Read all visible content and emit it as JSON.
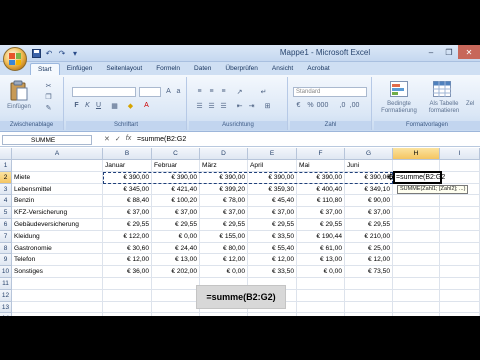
{
  "window": {
    "title": "Mappe1 - Microsoft Excel"
  },
  "tabs": [
    "Start",
    "Einfügen",
    "Seitenlayout",
    "Formeln",
    "Daten",
    "Überprüfen",
    "Ansicht",
    "Acrobat"
  ],
  "active_tab": "Start",
  "ribbon": {
    "paste_label": "Einfügen",
    "groups": {
      "clipboard": "Zwischenablage",
      "font": "Schriftart",
      "alignment": "Ausrichtung",
      "number": "Zahl",
      "templates": "Formatvorlagen"
    },
    "number_format_value": "Standard",
    "cond_format_label": "Bedingte Formatierung",
    "table_format_label": "Als Tabelle formatieren",
    "cell_styles_label": "Zel"
  },
  "formula_bar": {
    "name_box": "SUMME",
    "formula": "=summe(B2:G2"
  },
  "columns": [
    "A",
    "B",
    "C",
    "D",
    "E",
    "F",
    "G",
    "H",
    "I"
  ],
  "rows": [
    "1",
    "2",
    "3",
    "4",
    "5",
    "6",
    "7",
    "8",
    "9",
    "10",
    "11",
    "12",
    "13",
    "14"
  ],
  "sheet": {
    "months": [
      "Januar",
      "Februar",
      "März",
      "April",
      "Mai",
      "Juni"
    ],
    "data": [
      {
        "label": "Miete",
        "values": [
          "€ 390,00",
          "€ 390,00",
          "€ 390,00",
          "€ 390,00",
          "€ 390,00",
          "€ 390,00"
        ]
      },
      {
        "label": "Lebensmittel",
        "values": [
          "€ 345,00",
          "€ 421,40",
          "€ 399,20",
          "€ 359,30",
          "€ 400,40",
          "€ 349,10"
        ]
      },
      {
        "label": "Benzin",
        "values": [
          "€ 88,40",
          "€ 100,20",
          "€ 78,00",
          "€ 45,40",
          "€ 110,80",
          "€ 90,00"
        ]
      },
      {
        "label": "KFZ-Versicherung",
        "values": [
          "€ 37,00",
          "€ 37,00",
          "€ 37,00",
          "€ 37,00",
          "€ 37,00",
          "€ 37,00"
        ]
      },
      {
        "label": "Gebäudeversicherung",
        "values": [
          "€ 29,55",
          "€ 29,55",
          "€ 29,55",
          "€ 29,55",
          "€ 29,55",
          "€ 29,55"
        ]
      },
      {
        "label": "Kleidung",
        "values": [
          "€ 122,00",
          "€ 0,00",
          "€ 155,00",
          "€ 33,50",
          "€ 190,44",
          "€ 210,00"
        ]
      },
      {
        "label": "Gastronomie",
        "values": [
          "€ 30,60",
          "€ 24,40",
          "€ 80,00",
          "€ 55,40",
          "€ 61,00",
          "€ 25,00"
        ]
      },
      {
        "label": "Telefon",
        "values": [
          "€ 12,00",
          "€ 13,00",
          "€ 12,00",
          "€ 12,00",
          "€ 13,00",
          "€ 12,00"
        ]
      },
      {
        "label": "Sonstiges",
        "values": [
          "€ 36,00",
          "€ 202,00",
          "€ 0,00",
          "€ 33,50",
          "€ 0,00",
          "€ 73,50"
        ]
      }
    ],
    "active_cell_text": "=summe(B2:G2",
    "tooltip": "SUMME(Zahl1; [Zahl2]; ...)"
  },
  "caption": "=summe(B2:G2)",
  "icons": {
    "office_button": "office-logo-icon",
    "save": "save-icon",
    "undo": "undo-icon",
    "redo": "redo-icon",
    "paste": "paste-icon",
    "cut": "cut-icon",
    "copy": "copy-icon",
    "format_painter": "format-painter-icon",
    "bold": "bold-icon",
    "italic": "italic-icon",
    "underline": "underline-icon",
    "cond_format": "conditional-format-icon",
    "table_format": "table-format-icon",
    "cancel": "cancel-icon",
    "enter": "check-icon",
    "fx": "fx-icon"
  },
  "colors": {
    "ribbon_bg": "#dbe7f6",
    "header_selected": "#f4c561",
    "marquee": "#1f3f79",
    "close_button": "#c7675a"
  }
}
